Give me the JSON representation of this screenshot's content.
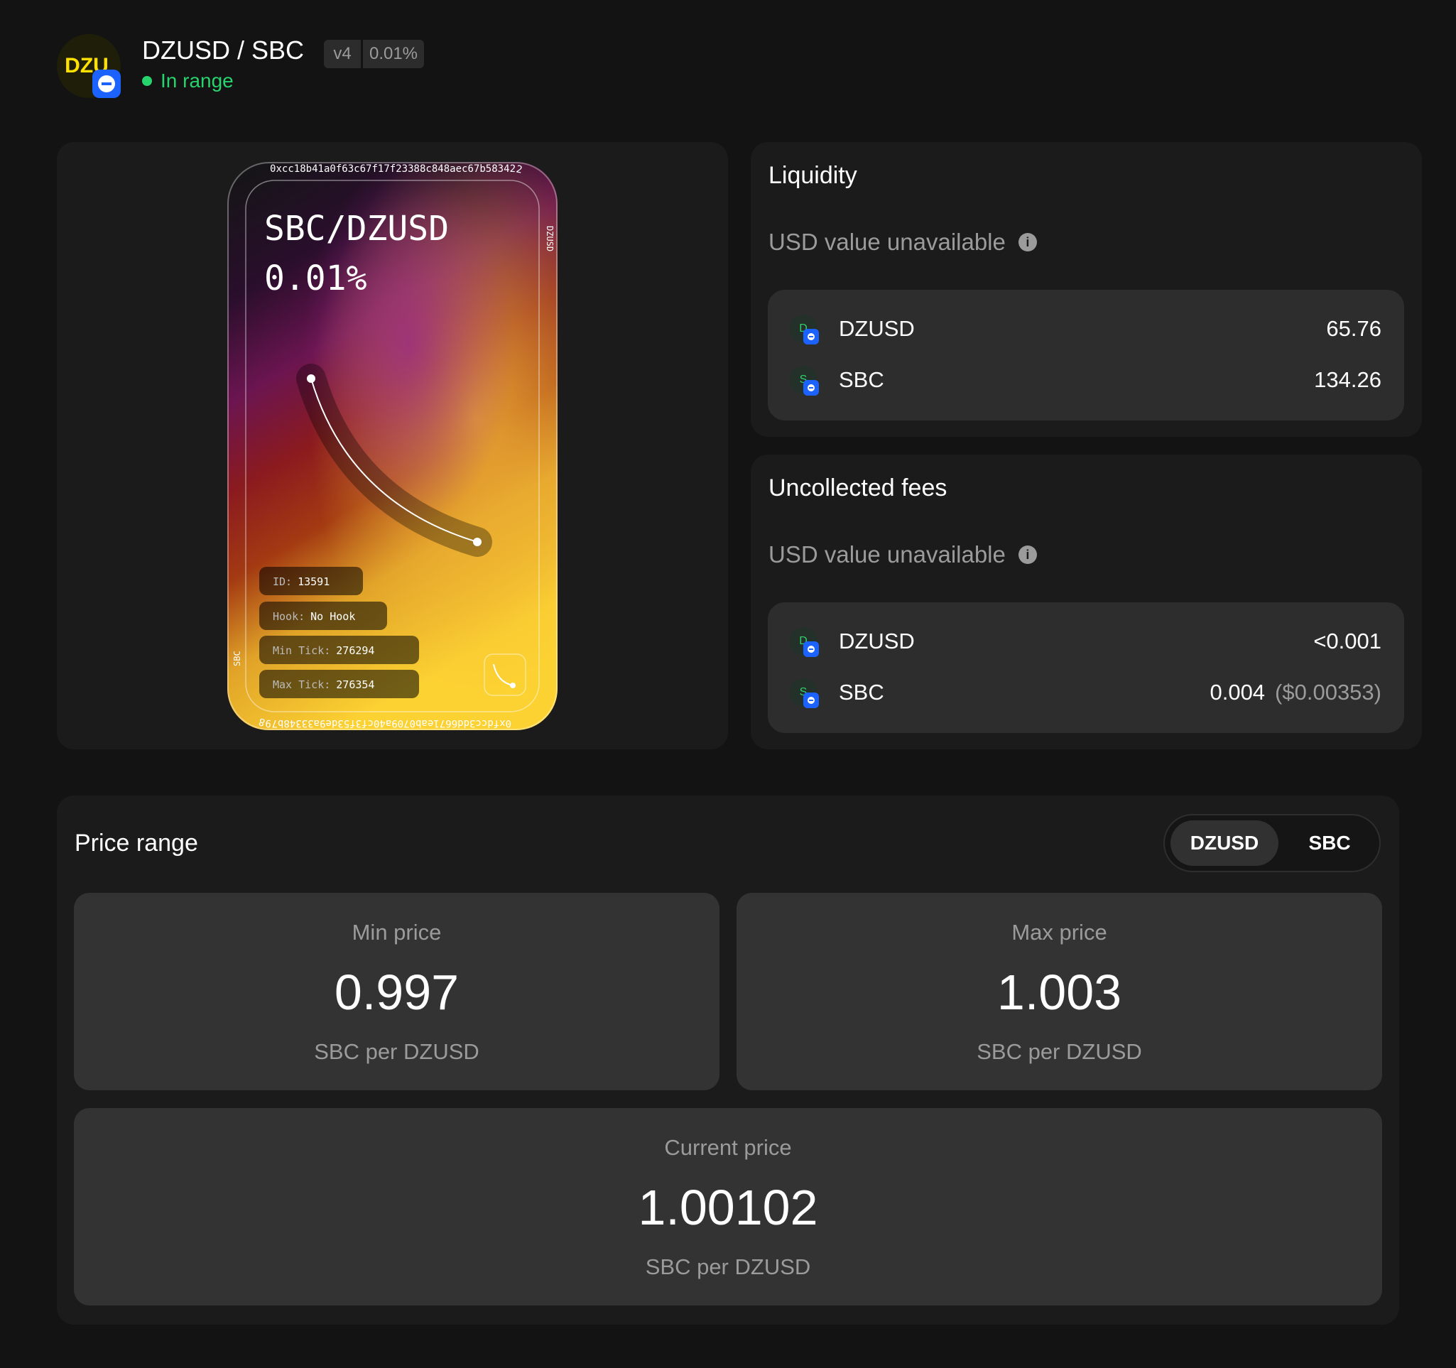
{
  "header": {
    "pair_title": "DZUSD / SBC",
    "version": "v4",
    "fee_tier": "0.01%",
    "status": "In range",
    "logo_text": "DZU",
    "colors": {
      "status": "#27d36c",
      "badge": "#1b62ff",
      "logo_text": "#ffe100"
    }
  },
  "nft": {
    "pair": "SBC/DZUSD",
    "fee": "0.01%",
    "address_top": "0xcc18b41a0f63c67f17f23388c848aec67b583422",
    "address_bottom": "0xfdcc3dd6671eab0709a40cf3f53de9a33348b798",
    "side_right": "DZUSD",
    "side_left": "SBC",
    "id_label": "ID:",
    "id_value": "13591",
    "hook_label": "Hook:",
    "hook_value": "No Hook",
    "min_tick_label": "Min Tick:",
    "min_tick_value": "276294",
    "max_tick_label": "Max Tick:",
    "max_tick_value": "276354"
  },
  "liquidity": {
    "title": "Liquidity",
    "usd_note": "USD value unavailable",
    "tokens": [
      {
        "symbol": "DZUSD",
        "icon_letter": "D",
        "amount": "65.76"
      },
      {
        "symbol": "SBC",
        "icon_letter": "S",
        "amount": "134.26"
      }
    ]
  },
  "fees": {
    "title": "Uncollected fees",
    "usd_note": "USD value unavailable",
    "tokens": [
      {
        "symbol": "DZUSD",
        "icon_letter": "D",
        "amount": "<0.001",
        "usd": ""
      },
      {
        "symbol": "SBC",
        "icon_letter": "S",
        "amount": "0.004",
        "usd": "($0.00353)"
      }
    ]
  },
  "price_range": {
    "title": "Price range",
    "toggle": {
      "selected": "DZUSD",
      "other": "SBC"
    },
    "min": {
      "label": "Min price",
      "value": "0.997",
      "unit": "SBC per DZUSD"
    },
    "max": {
      "label": "Max price",
      "value": "1.003",
      "unit": "SBC per DZUSD"
    },
    "current": {
      "label": "Current price",
      "value": "1.00102",
      "unit": "SBC per DZUSD"
    }
  }
}
